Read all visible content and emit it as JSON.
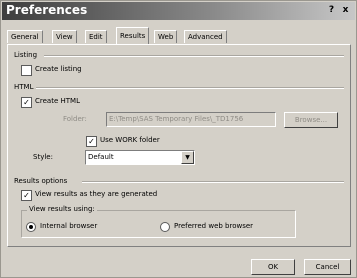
{
  "window": {
    "title": "Preferences",
    "help_button": "?",
    "close_button": "x"
  },
  "tabs": [
    {
      "label": "General",
      "active": false
    },
    {
      "label": "View",
      "active": false
    },
    {
      "label": "Edit",
      "active": false
    },
    {
      "label": "Results",
      "active": true
    },
    {
      "label": "Web",
      "active": false
    },
    {
      "label": "Advanced",
      "active": false
    }
  ],
  "listing": {
    "heading": "Listing",
    "create_label": "Create listing",
    "create_checked": false
  },
  "html": {
    "heading": "HTML",
    "create_label": "Create HTML",
    "create_checked": true,
    "folder_label": "Folder:",
    "folder_value": "E:\\Temp\\SAS Temporary Files\\_TD1756",
    "browse_label": "Browse...",
    "work_folder_label": "Use WORK folder",
    "work_folder_checked": true,
    "style_label": "Style:",
    "style_value": "Default"
  },
  "results_options": {
    "heading": "Results options",
    "view_as_generated_label": "View results as they are generated",
    "view_as_generated_checked": true,
    "view_using_heading": "View results using:",
    "internal_browser_label": "Internal browser",
    "preferred_browser_label": "Preferred web browser",
    "selected": "Internal browser"
  },
  "footer": {
    "ok_label": "OK",
    "cancel_label": "Cancel"
  }
}
